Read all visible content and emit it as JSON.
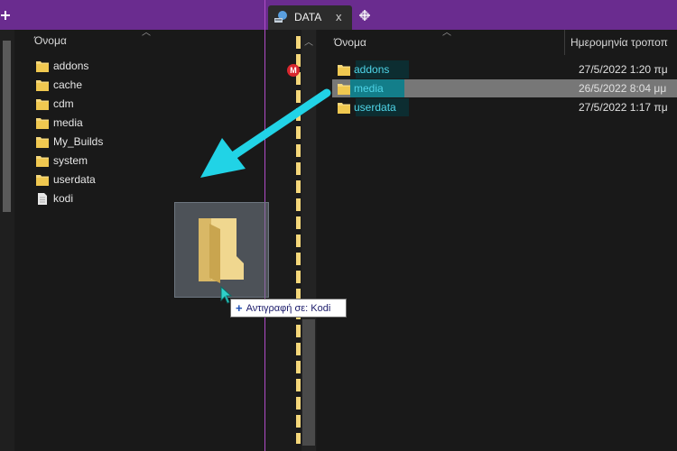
{
  "left_pane": {
    "column_name": "Όνομα",
    "items": [
      {
        "label": "addons",
        "icon": "folder-icon"
      },
      {
        "label": "cache",
        "icon": "folder-icon"
      },
      {
        "label": "cdm",
        "icon": "folder-icon"
      },
      {
        "label": "media",
        "icon": "folder-icon"
      },
      {
        "label": "My_Builds",
        "icon": "folder-icon"
      },
      {
        "label": "system",
        "icon": "folder-icon"
      },
      {
        "label": "userdata",
        "icon": "folder-icon"
      },
      {
        "label": "kodi",
        "icon": "file-icon"
      }
    ]
  },
  "right_tab": {
    "label": "DATA",
    "close_label": "x"
  },
  "quick_access": {
    "mega_label": "M"
  },
  "right_pane": {
    "column_name": "Όνομα",
    "column_date": "Ημερομηνία τροποπ",
    "items": [
      {
        "label": "addons",
        "date": "27/5/2022 1:20 πμ"
      },
      {
        "label": "media",
        "date": "26/5/2022 8:04 μμ"
      },
      {
        "label": "userdata",
        "date": "27/5/2022 1:17 πμ"
      }
    ]
  },
  "drag": {
    "tooltip_plus": "+",
    "tooltip_text": "Αντιγραφή σε: Kodi"
  },
  "colors": {
    "tabbar": "#6a2c8f",
    "accent_arrow": "#21d3e6",
    "folder": "#f5d77a",
    "selected_row": "#777777"
  }
}
